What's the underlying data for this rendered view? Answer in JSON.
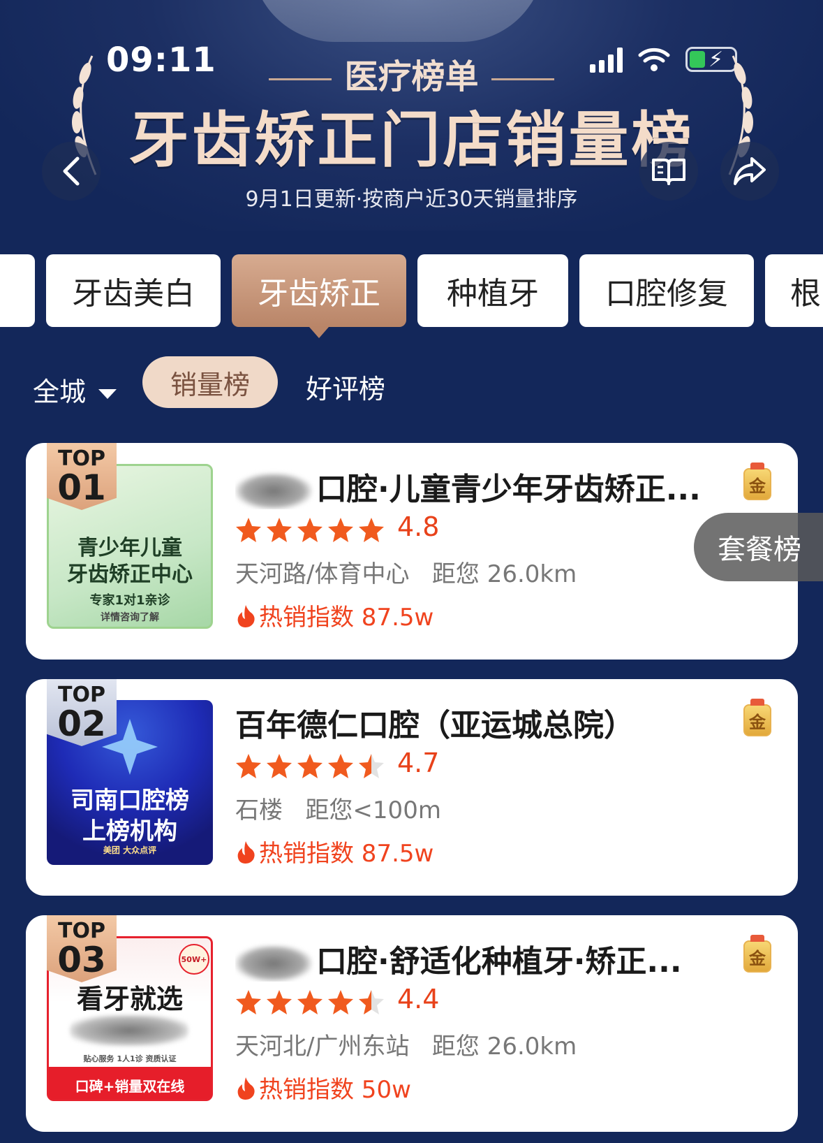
{
  "status_bar": {
    "time": "09:11"
  },
  "header": {
    "tag": "医疗榜单",
    "title": "牙齿矫正门店销量榜",
    "subtitle": "9月1日更新·按商户近30天销量排序"
  },
  "tabs": [
    {
      "label": "",
      "active": false
    },
    {
      "label": "牙齿美白",
      "active": false
    },
    {
      "label": "牙齿矫正",
      "active": true
    },
    {
      "label": "种植牙",
      "active": false
    },
    {
      "label": "口腔修复",
      "active": false
    },
    {
      "label": "根",
      "active": false
    }
  ],
  "filters": {
    "city": "全城",
    "sales_tab": "销量榜",
    "review_tab": "好评榜"
  },
  "float_button": "套餐榜",
  "stores": [
    {
      "rank_top": "TOP",
      "rank_num": "01",
      "name": "口腔·儿童青少年牙齿矫正...",
      "name_blurred_prefix": true,
      "medal": "金",
      "stars": 5,
      "rating": "4.8",
      "location": "天河路/体育中心",
      "distance": "距您 26.0km",
      "hot_label": "热销指数 87.5w",
      "thumb": {
        "line1": "青少年儿童",
        "line2": "牙齿矫正中心",
        "line3": "专家1对1亲诊",
        "line4": "详情咨询了解"
      }
    },
    {
      "rank_top": "TOP",
      "rank_num": "02",
      "name": "百年德仁口腔（亚运城总院）",
      "name_blurred_prefix": false,
      "medal": "金",
      "stars": 4.5,
      "rating": "4.7",
      "location": "石楼",
      "distance": "距您<100m",
      "hot_label": "热销指数 87.5w",
      "thumb": {
        "line1": "司南口腔榜",
        "line2": "上榜机构",
        "line3": "美团 大众点评",
        "line4": ""
      }
    },
    {
      "rank_top": "TOP",
      "rank_num": "03",
      "name": "口腔·舒适化种植牙·矫正...",
      "name_blurred_prefix": true,
      "medal": "金",
      "stars": 4.5,
      "rating": "4.4",
      "location": "天河北/广州东站",
      "distance": "距您 26.0km",
      "hot_label": "热销指数 50w",
      "thumb": {
        "line1": "看牙就选",
        "line2": "50W+",
        "line3": "贴心服务  1人1诊  资质认证",
        "line4": "口碑+销量双在线"
      }
    }
  ],
  "colors": {
    "background": "#13275a",
    "accent_copper": "#b98568",
    "rating_red": "#e8421a",
    "star_orange": "#f05a1e"
  }
}
